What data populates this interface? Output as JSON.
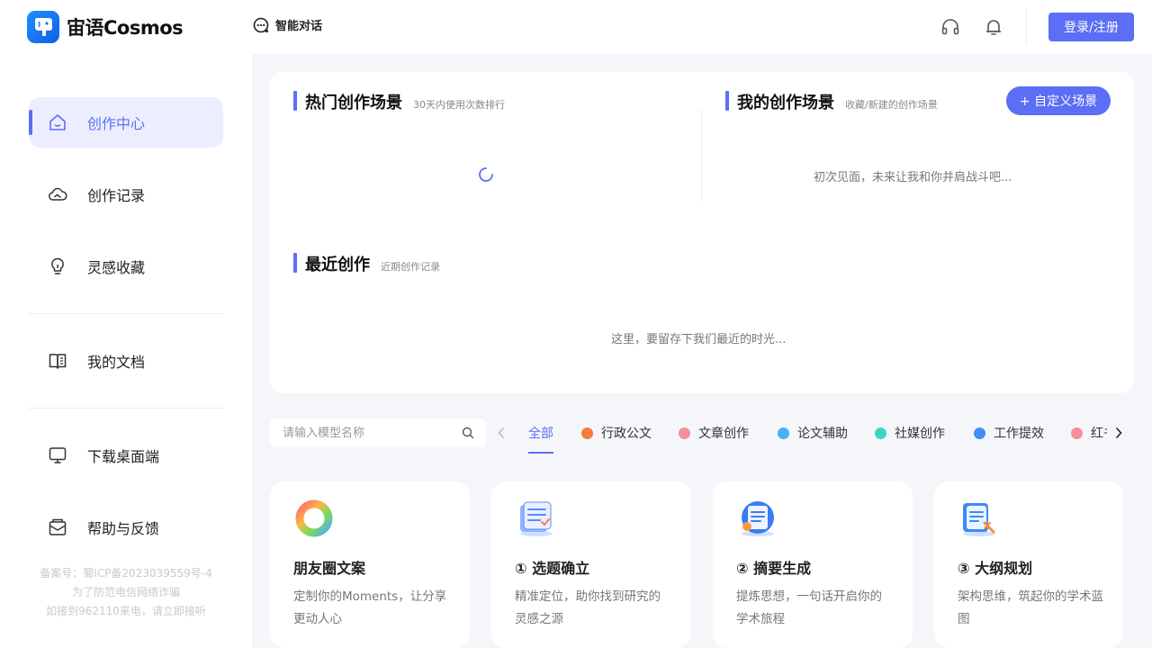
{
  "header": {
    "app_name": "宙语Cosmos",
    "nav_chat_label": "智能对话",
    "login_label": "登录/注册",
    "icons": [
      "headset-icon",
      "bell-icon"
    ],
    "accent_color": "#5b6ef5"
  },
  "sidebar": {
    "items": [
      {
        "label": "创作中心",
        "icon": "home-icon",
        "active": true
      },
      {
        "label": "创作记录",
        "icon": "cloud-icon",
        "active": false
      },
      {
        "label": "灵感收藏",
        "icon": "lightbulb-icon",
        "active": false
      },
      {
        "label": "我的文档",
        "icon": "book-icon",
        "active": false
      },
      {
        "label": "下载桌面端",
        "icon": "monitor-icon",
        "active": false
      },
      {
        "label": "帮助与反馈",
        "icon": "mail-icon",
        "active": false
      }
    ],
    "icp": [
      "备案号：蜀ICP备2023039559号-4",
      "为了防范电信网络诈骗",
      "如接到962110来电，请立即接听"
    ]
  },
  "hot": {
    "title": "热门创作场景",
    "subtitle": "30天内使用次数排行"
  },
  "mine": {
    "title": "我的创作场景",
    "subtitle": "收藏/新建的创作场景",
    "custom_button": "+ 自定义场景",
    "empty_text": "初次见面，未来让我和你并肩战斗吧..."
  },
  "recent": {
    "title": "最近创作",
    "subtitle": "近期创作记录",
    "empty_text": "这里，要留存下我们最近的时光..."
  },
  "filter": {
    "search_placeholder": "请输入模型名称",
    "tabs": [
      {
        "label": "全部",
        "color": null,
        "active": true
      },
      {
        "label": "行政公文",
        "color": "#f47d3e",
        "active": false
      },
      {
        "label": "文章创作",
        "color": "#f58f9c",
        "active": false
      },
      {
        "label": "论文辅助",
        "color": "#43b3f4",
        "active": false
      },
      {
        "label": "社媒创作",
        "color": "#3fd5c3",
        "active": false
      },
      {
        "label": "工作提效",
        "color": "#3f8ff4",
        "active": false
      },
      {
        "label": "红书",
        "color": "#f58f9c",
        "active": false
      }
    ]
  },
  "cards": [
    {
      "title": "朋友圈文案",
      "desc": "定制你的Moments，让分享更动人心",
      "icon": "color-ring-icon"
    },
    {
      "title": "① 选题确立",
      "desc": "精准定位，助你找到研究的灵感之源",
      "icon": "topic-doc-icon"
    },
    {
      "title": "② 摘要生成",
      "desc": "提炼思想，一句话开启你的学术旅程",
      "icon": "summary-doc-icon"
    },
    {
      "title": "③ 大纲规划",
      "desc": "架构思维，筑起你的学术蓝图",
      "icon": "outline-doc-icon"
    }
  ]
}
